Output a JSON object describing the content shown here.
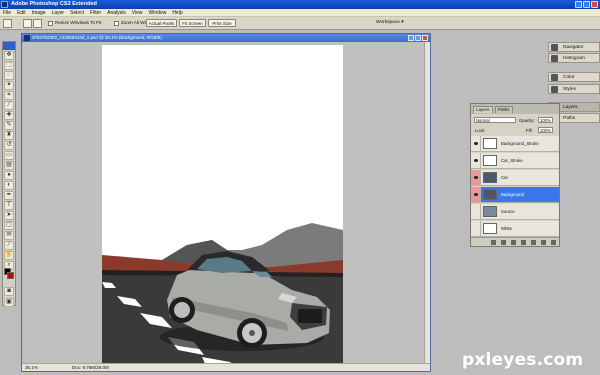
{
  "app": {
    "title": "Adobe Photoshop CS3 Extended"
  },
  "menu": [
    "File",
    "Edit",
    "Image",
    "Layer",
    "Select",
    "Filter",
    "Analysis",
    "View",
    "Window",
    "Help"
  ],
  "options": {
    "resize_windows": "Resize Windows To Fit",
    "zoom_all": "Zoom All Windows",
    "actual_pixels": "Actual Pixels",
    "fit_screen": "Fit Screen",
    "print_size": "Print Size",
    "workspace": "Workspace ▾"
  },
  "document": {
    "title": "3794762382_c43359434d_o.psd @ 36.1% (Background, RGB/8)",
    "zoom": "36.1%",
    "info": "Doc: 9.76M/29.0M"
  },
  "panels": {
    "navigator": "Navigator",
    "histogram": "Histogram",
    "color": "Color",
    "styles": "Styles",
    "layers": "Layers",
    "paths": "Paths"
  },
  "layers_panel": {
    "tab_layers": "Layers",
    "tab_paths": "Paths",
    "blend_mode": "Normal",
    "opacity_label": "Opacity:",
    "opacity": "100%",
    "lock_label": "Lock:",
    "fill_label": "Fill:",
    "fill": "100%",
    "layers": [
      {
        "name": "Background_Stroke",
        "visible": true,
        "selected": false
      },
      {
        "name": "Car_Stroke",
        "visible": true,
        "selected": false
      },
      {
        "name": "Car",
        "visible": true,
        "selected": false
      },
      {
        "name": "Background",
        "visible": true,
        "selected": true
      },
      {
        "name": "Source",
        "visible": false,
        "selected": false
      },
      {
        "name": "White",
        "visible": false,
        "selected": false
      }
    ]
  },
  "colors": {
    "accent": "#3878e8",
    "titlebar": "#1a5ad8"
  },
  "watermark": "pxleyes.com"
}
